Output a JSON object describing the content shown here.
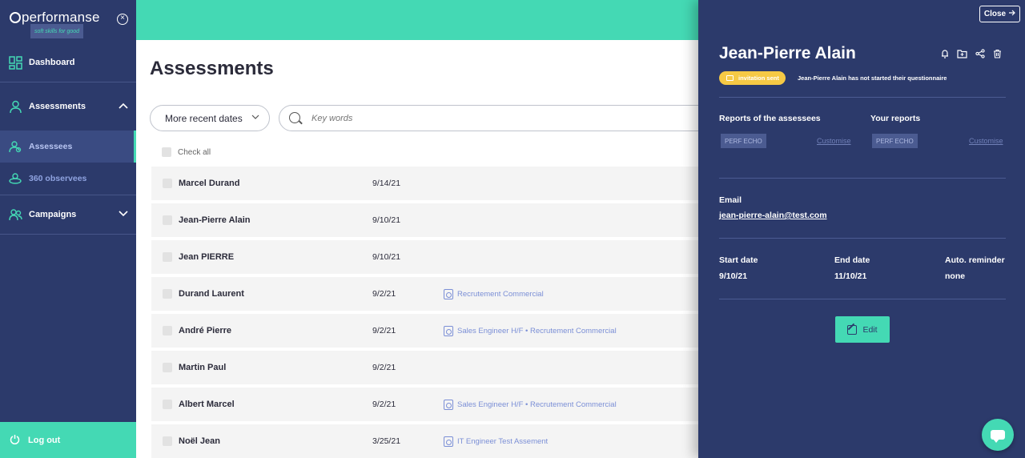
{
  "sidebar": {
    "logo_text": "performanse",
    "logo_tagline": "soft skills for good",
    "items": [
      {
        "label": "Dashboard",
        "icon": "dashboard-icon"
      },
      {
        "label": "Assessments",
        "icon": "person-icon"
      },
      {
        "label": "Assessees",
        "icon": "assessee-icon"
      },
      {
        "label": "360 observees",
        "icon": "observees-icon"
      },
      {
        "label": "Campaigns",
        "icon": "group-icon"
      }
    ],
    "logout_label": "Log out"
  },
  "main": {
    "title": "Assessments",
    "filter_label": "More recent dates",
    "search_placeholder": "Key words",
    "check_all_label": "Check all",
    "rows": [
      {
        "name": "Marcel Durand",
        "date": "9/14/21",
        "campaign": ""
      },
      {
        "name": "Jean-Pierre Alain",
        "date": "9/10/21",
        "campaign": ""
      },
      {
        "name": "Jean PIERRE",
        "date": "9/10/21",
        "campaign": ""
      },
      {
        "name": "Durand Laurent",
        "date": "9/2/21",
        "campaign": "Recrutement Commercial"
      },
      {
        "name": "André Pierre",
        "date": "9/2/21",
        "campaign": "Sales Engineer H/F • Recrutement Commercial"
      },
      {
        "name": "Martin Paul",
        "date": "9/2/21",
        "campaign": ""
      },
      {
        "name": "Albert Marcel",
        "date": "9/2/21",
        "campaign": "Sales Engineer H/F • Recrutement Commercial"
      },
      {
        "name": "Noël Jean",
        "date": "3/25/21",
        "campaign": "IT Engineer Test Assement"
      }
    ]
  },
  "panel": {
    "close_label": "Close",
    "name": "Jean-Pierre Alain",
    "status_badge": "invitation sent",
    "status_text": "Jean-Pierre Alain has not started their questionnaire",
    "reports_assessees_label": "Reports of the assessees",
    "your_reports_label": "Your reports",
    "report_tag": "PERF ECHO",
    "customise_label": "Customise",
    "email_label": "Email",
    "email_value": "jean-pierre-alain@test.com",
    "start_date_label": "Start date",
    "start_date_value": "9/10/21",
    "end_date_label": "End date",
    "end_date_value": "11/10/21",
    "reminder_label": "Auto. reminder",
    "reminder_value": "none",
    "edit_label": "Edit"
  },
  "colors": {
    "sidebar_bg": "#2c3a6b",
    "accent": "#44d9b4",
    "badge_yellow": "#f6c945",
    "link_blue": "#7b8fd6"
  }
}
